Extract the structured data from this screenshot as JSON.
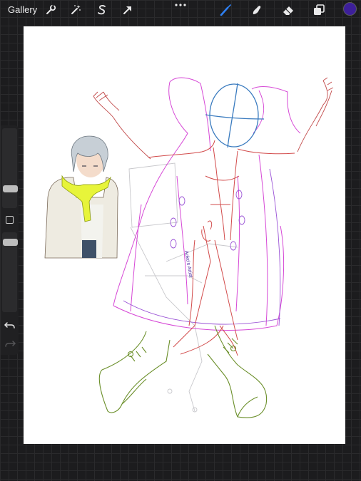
{
  "toolbar": {
    "gallery_label": "Gallery",
    "actions_icon": "wrench-icon",
    "adjustments_icon": "magic-wand-icon",
    "selection_icon": "selection-s-icon",
    "transform_icon": "arrow-cursor-icon",
    "more_icon": "more-ellipsis-icon",
    "brush_icon": "brush-icon",
    "smudge_icon": "smudge-finger-icon",
    "eraser_icon": "eraser-icon",
    "layers_icon": "layers-icon",
    "active_tool": "brush",
    "active_color": "#3d1f9a"
  },
  "sidebar": {
    "brush_size_icon": "slider-handle",
    "opacity_icon": "slider-handle",
    "modify_icon": "square-modify-icon",
    "undo_icon": "undo-arrow-icon",
    "redo_icon": "redo-arrow-icon"
  },
  "canvas": {
    "background": "#ffffff",
    "signature_text": "Aoko's Artist",
    "colors": {
      "head_guide": "#3a7bbf",
      "body_red": "#d24b4b",
      "cape_magenta": "#d648d6",
      "cape_violet": "#9a52d6",
      "boots_green": "#6b8f2a",
      "sketch_grey": "#c8c8cc"
    }
  }
}
